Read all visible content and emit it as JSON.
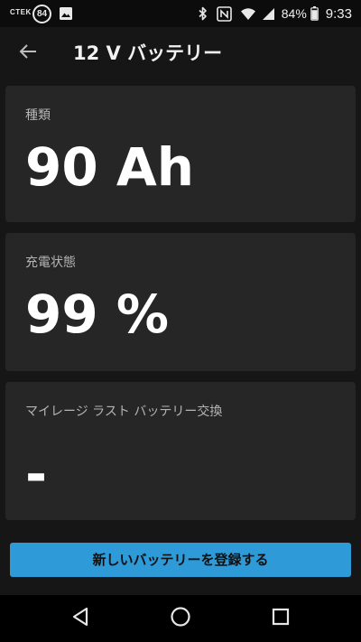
{
  "status_bar": {
    "app_indicator": "CTEK",
    "badge": "84",
    "battery_percent": "84%",
    "time": "9:33",
    "icons": [
      "image-icon",
      "bluetooth-icon",
      "nfc-icon",
      "wifi-icon",
      "signal-icon",
      "battery-icon"
    ]
  },
  "header": {
    "back_icon": "arrow-left-icon",
    "title": "12 V バッテリー"
  },
  "cards": [
    {
      "label": "種類",
      "value": "90 Ah"
    },
    {
      "label": "充電状態",
      "value": "99 %"
    },
    {
      "label": "マイレージ ラスト バッテリー交換",
      "value": "-"
    }
  ],
  "action": {
    "register_label": "新しいバッテリーを登録する",
    "color": "#2e9ad8"
  },
  "nav": {
    "icons": [
      "back-triangle-icon",
      "home-circle-icon",
      "recents-square-icon"
    ]
  },
  "colors": {
    "background": "#161616",
    "card": "#262626",
    "label": "#b4b4b4",
    "accent": "#2e9ad8"
  }
}
